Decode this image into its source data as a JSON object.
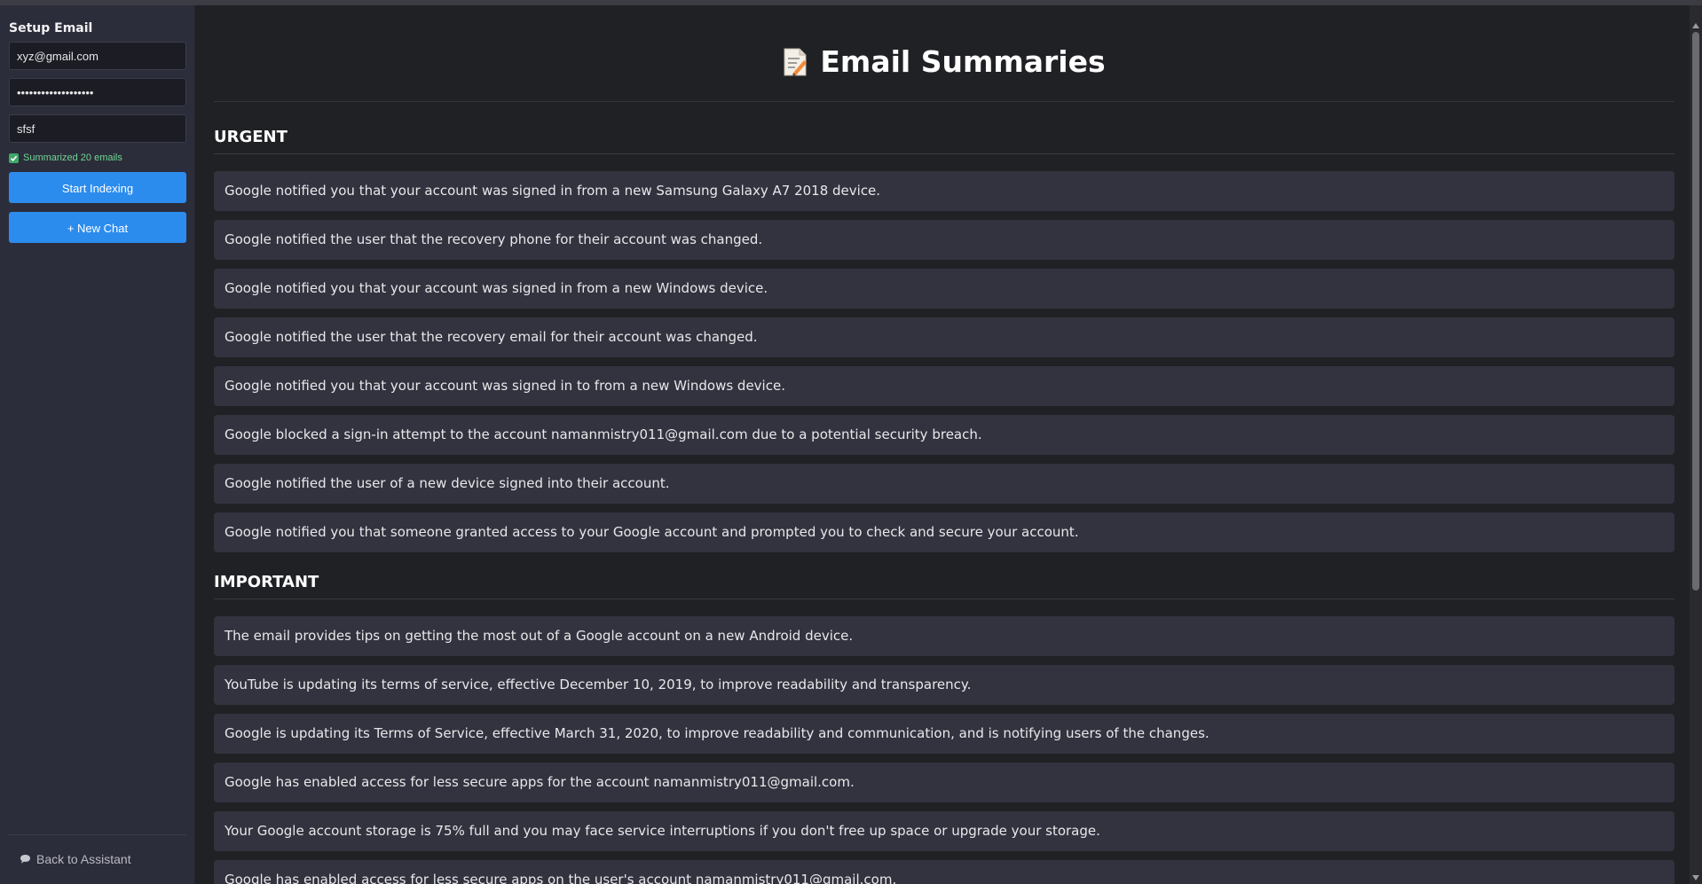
{
  "sidebar": {
    "title": "Setup Email",
    "email_value": "xyz@gmail.com",
    "password_value": "•••••••••••••••••••",
    "third_value": "sfsf",
    "status_text": "Summarized 20 emails",
    "start_indexing_label": "Start Indexing",
    "new_chat_label": "+ New Chat",
    "back_label": "Back to Assistant"
  },
  "main": {
    "title": "Email Summaries",
    "sections": [
      {
        "heading": "URGENT",
        "items": [
          "Google notified you that your account was signed in from a new Samsung Galaxy A7 2018 device.",
          "Google notified the user that the recovery phone for their account was changed.",
          "Google notified you that your account was signed in from a new Windows device.",
          "Google notified the user that the recovery email for their account was changed.",
          "Google notified you that your account was signed in to from a new Windows device.",
          "Google blocked a sign-in attempt to the account namanmistry011@gmail.com due to a potential security breach.",
          "Google notified the user of a new device signed into their account.",
          "Google notified you that someone granted access to your Google account and prompted you to check and secure your account."
        ]
      },
      {
        "heading": "IMPORTANT",
        "items": [
          "The email provides tips on getting the most out of a Google account on a new Android device.",
          "YouTube is updating its terms of service, effective December 10, 2019, to improve readability and transparency.",
          "Google is updating its Terms of Service, effective March 31, 2020, to improve readability and communication, and is notifying users of the changes.",
          "Google has enabled access for less secure apps for the account namanmistry011@gmail.com.",
          "Your Google account storage is 75% full and you may face service interruptions if you don't free up space or upgrade your storage.",
          "Google has enabled access for less secure apps on the user's account namanmistry011@gmail.com."
        ]
      }
    ]
  },
  "colors": {
    "accent": "#2b8cee",
    "success": "#6fd694",
    "background": "#202124",
    "sidebar": "#2c2d3a",
    "card": "#32333f"
  }
}
